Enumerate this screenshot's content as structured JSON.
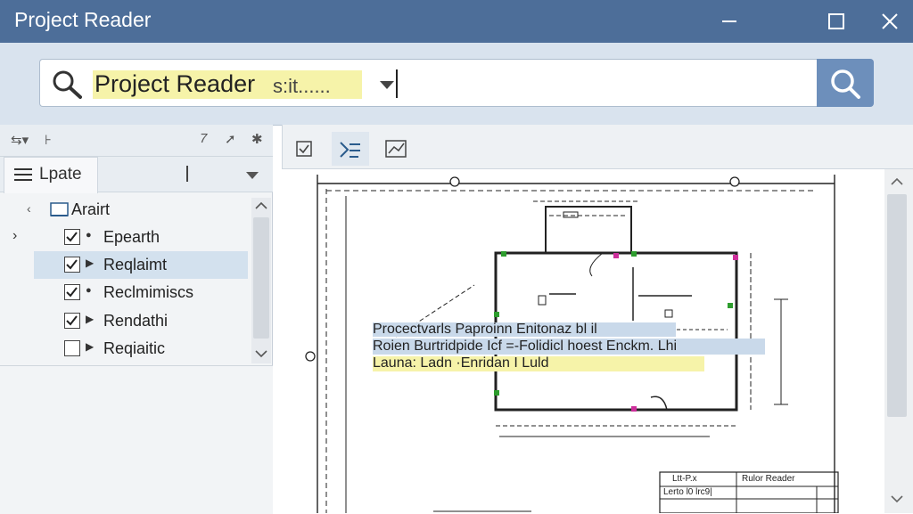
{
  "window": {
    "title": "Project Reader"
  },
  "search": {
    "value": "Project Reader",
    "ghost": "s:it......"
  },
  "left_panel": {
    "tab_label": "Lpate",
    "root_label": "Arairt",
    "items": [
      {
        "label": "Epearth",
        "checked": true,
        "selected": false
      },
      {
        "label": "Reqlaimt",
        "checked": true,
        "selected": true
      },
      {
        "label": "Reclmimiscs",
        "checked": true,
        "selected": false
      },
      {
        "label": "Rendathi",
        "checked": true,
        "selected": false
      },
      {
        "label": "Reqiaitic",
        "checked": false,
        "selected": false
      }
    ]
  },
  "drawing": {
    "line1": "Procectvarls Paproinn  Enitonaz bl  il",
    "line2": "Roien  Burtridpide  Icf =-Folidicl hoest  Enckm.  Lhi",
    "line3": "Launa:  Ladn   ·Enridan  I     Luld",
    "title_block": {
      "cell_a": "Ltt-P.x",
      "cell_b": "Rulor Reader",
      "cell_c": "Lerto l0 lrc9|"
    }
  },
  "colors": {
    "titlebar": "#4d6e99",
    "search_button": "#6d8fbb",
    "highlight_yellow": "#f6f3a9",
    "highlight_blue": "#c9d9ea",
    "selection": "#d3e1ee"
  },
  "icons": [
    "search-icon",
    "dropdown-arrow-icon",
    "minimize-icon",
    "maximize-icon",
    "close-icon",
    "list-icon",
    "checkbox-icon",
    "edit-icon",
    "chart-icon",
    "pin-icon",
    "settings-icon"
  ]
}
